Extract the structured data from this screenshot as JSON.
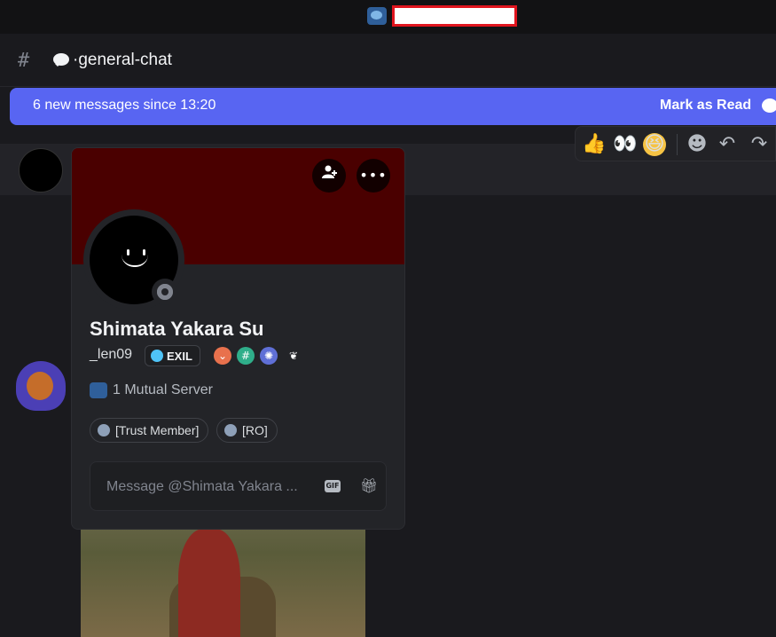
{
  "channel": {
    "name": "·general-chat",
    "icons": {
      "channel_type": "hash-lock-icon",
      "emoji": "speech-bubble-icon"
    }
  },
  "new_messages_bar": {
    "text": "6 new messages since 13:20",
    "mark_as_read": "Mark as Read",
    "icon": "mark-read-icon"
  },
  "message_actions": {
    "reactions": [
      "👍",
      "👀",
      "😆"
    ],
    "icons": [
      "add-reaction-icon",
      "reply-icon",
      "forward-icon"
    ]
  },
  "profile": {
    "display_name": "Shimata Yakara Su",
    "username": "_len09",
    "guild_tag": "EXIL",
    "status": "offline",
    "badges": [
      "hypesquad-badge",
      "hashtag-badge",
      "nitro-badge",
      "leaf-badge"
    ],
    "mutual_servers": "1 Mutual Server",
    "roles": [
      {
        "label": "[Trust Member]",
        "color": "#8ea0b8"
      },
      {
        "label": "[RO]",
        "color": "#8ea0b8"
      }
    ],
    "message_placeholder": "Message @Shimata Yakara ...",
    "colors": {
      "banner": "#4a0000",
      "accent": "#5865f2"
    }
  }
}
